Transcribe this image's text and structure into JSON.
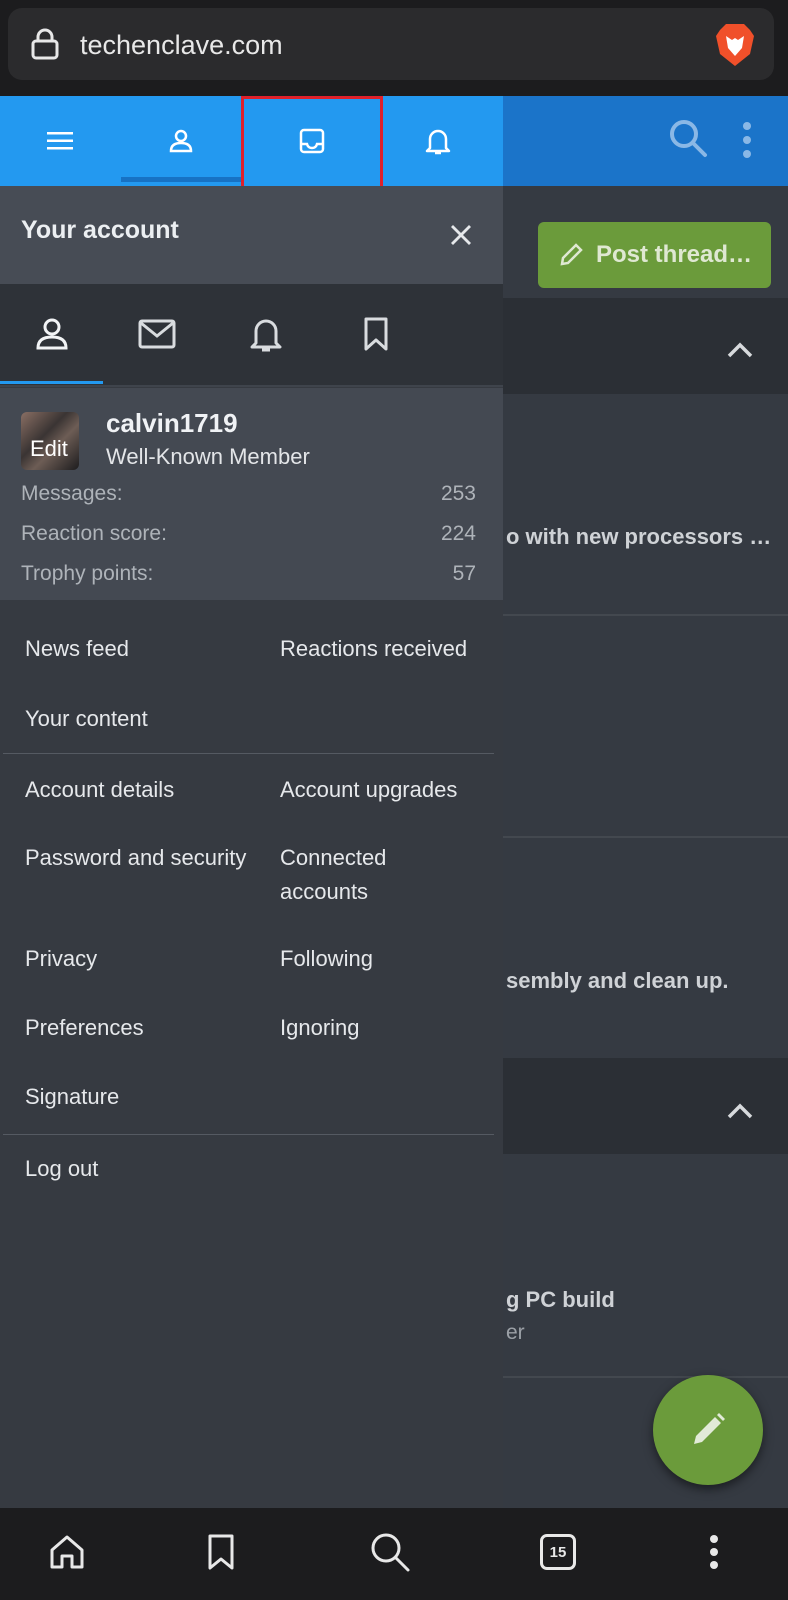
{
  "browser": {
    "url": "techenclave.com",
    "tab_count": "15"
  },
  "drawer": {
    "title": "Your account",
    "tabs": [
      "menu",
      "account",
      "inbox",
      "alerts"
    ]
  },
  "account_tabs": [
    "account",
    "messages",
    "alerts",
    "bookmarks"
  ],
  "profile": {
    "avatar_label": "Edit",
    "username": "calvin1719",
    "user_title": "Well-Known Member",
    "stats": [
      {
        "label": "Messages:",
        "value": "253"
      },
      {
        "label": "Reaction score:",
        "value": "224"
      },
      {
        "label": "Trophy points:",
        "value": "57"
      }
    ]
  },
  "menu": {
    "group1": {
      "news_feed": "News feed",
      "reactions_received": "Reactions received",
      "your_content": "Your content"
    },
    "group2": {
      "account_details": "Account details",
      "account_upgrades": "Account upgrades",
      "password_security": "Password and security",
      "connected_accounts": "Connected accounts",
      "privacy": "Privacy",
      "following": "Following",
      "preferences": "Preferences",
      "ignoring": "Ignoring",
      "signature": "Signature"
    },
    "logout": "Log out"
  },
  "background": {
    "post_thread": "Post thread…",
    "snippet1": "o with new processors …",
    "snippet2": "sembly and clean up.",
    "snippet3": "g PC build",
    "snippet3_sub": "er"
  },
  "colors": {
    "header_blue": "#1b74c9",
    "drawer_tab_blue": "#2399f0",
    "accent_green": "#6b9b3b",
    "highlight_red": "#e0202a"
  }
}
